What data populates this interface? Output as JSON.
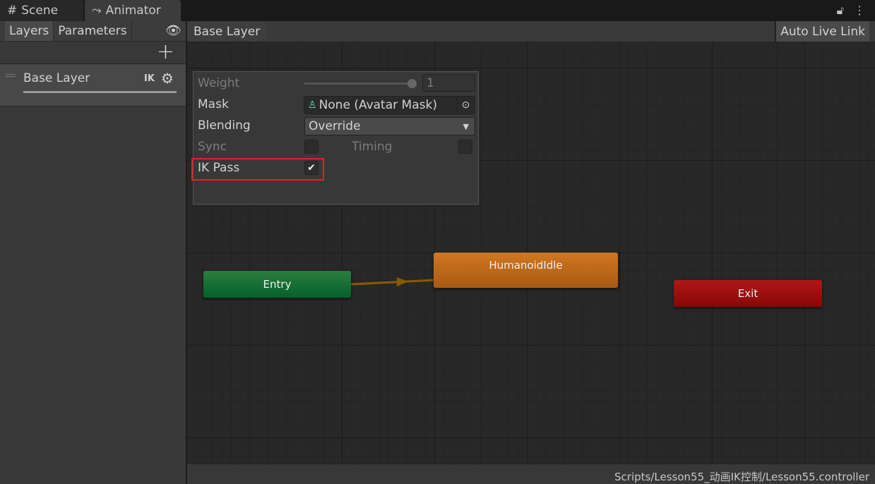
{
  "window": {
    "tabs": [
      {
        "label": "Scene",
        "icon": "grid-hash-icon"
      },
      {
        "label": "Animator",
        "icon": "animator-branch-icon"
      }
    ],
    "active_tab": "Animator",
    "lock_icon": "lock-icon",
    "menu_icon": "kebab-menu-icon"
  },
  "sidebar": {
    "tabs": [
      "Layers",
      "Parameters"
    ],
    "active": "Layers",
    "add_label": "+",
    "layers": [
      {
        "name": "Base Layer",
        "ik_badge": "IK",
        "weight": 1
      }
    ]
  },
  "breadcrumb": {
    "items": [
      "Base Layer"
    ],
    "auto_live_link": "Auto Live Link"
  },
  "layer_settings": {
    "weight_label": "Weight",
    "weight_value": "1",
    "weight_fraction": 1,
    "mask_label": "Mask",
    "mask_value": "None (Avatar Mask)",
    "blending_label": "Blending",
    "blending_value": "Override",
    "sync_label": "Sync",
    "sync_checked": false,
    "timing_label": "Timing",
    "timing_checked": false,
    "ik_pass_label": "IK Pass",
    "ik_pass_checked": true
  },
  "graph": {
    "nodes": [
      {
        "name": "Entry",
        "color": "#1a7034"
      },
      {
        "name": "HumanoidIdle",
        "color": "#c06a1a"
      },
      {
        "name": "Exit",
        "color": "#a01010"
      }
    ]
  },
  "status": {
    "path": "Scripts/Lesson55_动画IK控制/Lesson55.controller"
  },
  "colors": {
    "highlight": "#e3212a",
    "entry": "#1a7034",
    "state": "#c06a1a",
    "exit": "#a01010"
  }
}
